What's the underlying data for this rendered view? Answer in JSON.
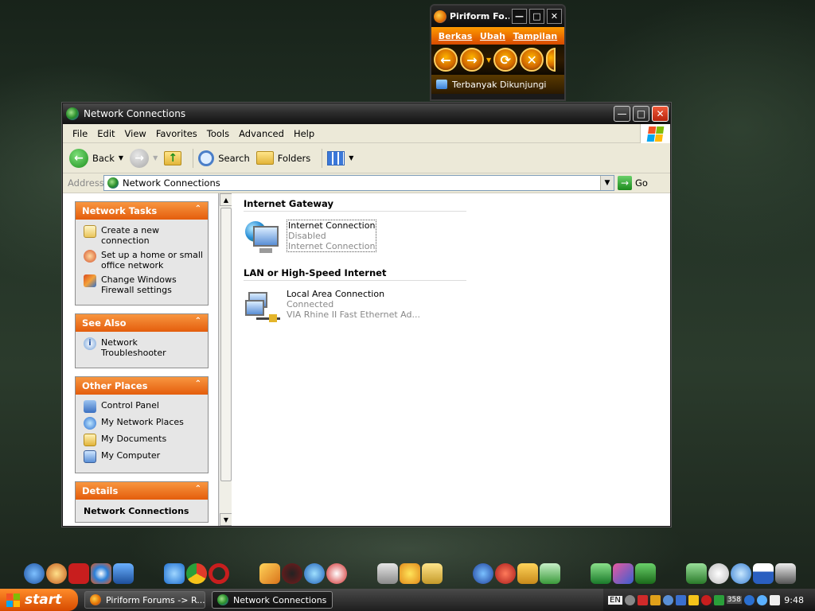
{
  "firefox": {
    "title": "Piriform Fo...",
    "menu": [
      "Berkas",
      "Ubah",
      "Tampilan"
    ],
    "bookmark": "Terbanyak Dikunjungi"
  },
  "window": {
    "title": "Network Connections",
    "menu": [
      "File",
      "Edit",
      "View",
      "Favorites",
      "Tools",
      "Advanced",
      "Help"
    ],
    "toolbar": {
      "back": "Back",
      "search": "Search",
      "folders": "Folders"
    },
    "address": {
      "label": "Address",
      "value": "Network Connections",
      "go": "Go"
    }
  },
  "tasks": {
    "network": {
      "title": "Network Tasks",
      "items": [
        "Create a new connection",
        "Set up a home or small office network",
        "Change Windows Firewall settings"
      ]
    },
    "see_also": {
      "title": "See Also",
      "items": [
        "Network Troubleshooter"
      ]
    },
    "other": {
      "title": "Other Places",
      "items": [
        "Control Panel",
        "My Network Places",
        "My Documents",
        "My Computer"
      ]
    },
    "details": {
      "title": "Details",
      "sub": "Network Connections"
    }
  },
  "content": {
    "group1": "Internet Gateway",
    "ic": {
      "name": "Internet Connection",
      "status": "Disabled",
      "type": "Internet Connection"
    },
    "group2": "LAN or High-Speed Internet",
    "lan": {
      "name": "Local Area Connection",
      "status": "Connected",
      "device": "VIA Rhine II Fast Ethernet Ad..."
    }
  },
  "taskbar": {
    "start": "start",
    "tasks": [
      "Piriform Forums -> R...",
      "Network Connections"
    ],
    "lang": "EN",
    "tray_badge": "358",
    "clock": "9:48"
  }
}
